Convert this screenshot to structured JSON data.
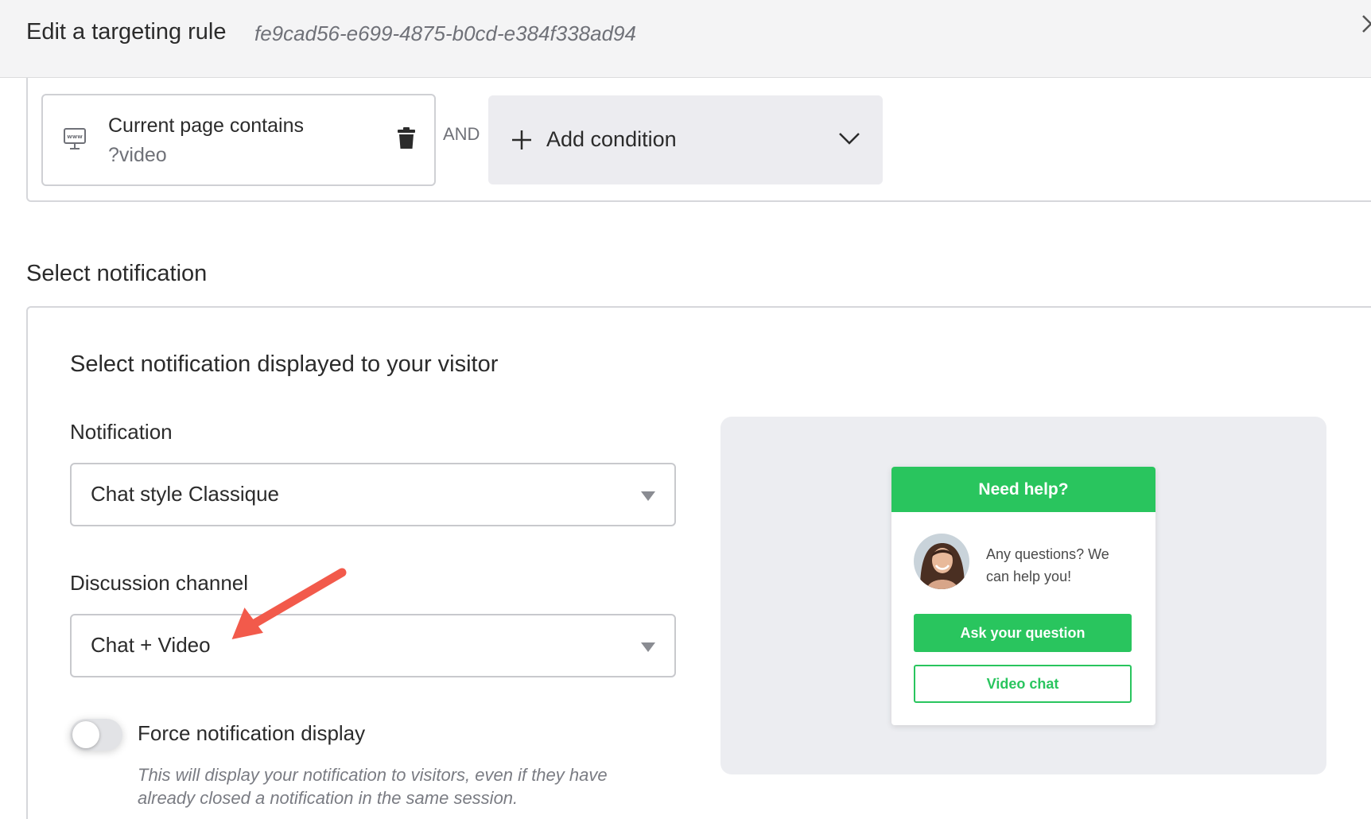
{
  "header": {
    "title": "Edit a targeting rule",
    "rule_id": "fe9cad56-e699-4875-b0cd-e384f338ad94"
  },
  "conditions": {
    "items": [
      {
        "title": "Current page contains",
        "value": "?video",
        "icon": "www-icon"
      }
    ],
    "operator": "AND",
    "add_label": "Add condition"
  },
  "section": {
    "title": "Select notification"
  },
  "notification_panel": {
    "title": "Select notification displayed to your visitor",
    "notification_label": "Notification",
    "notification_value": "Chat style Classique",
    "channel_label": "Discussion channel",
    "channel_value": "Chat + Video",
    "force_label": "Force notification display",
    "force_help": "This will display your notification to visitors, even if they have already closed a notification in the same session.",
    "force_enabled": false
  },
  "preview": {
    "header": "Need help?",
    "message": "Any questions? We can help you!",
    "ask_button": "Ask your question",
    "video_button": "Video chat"
  },
  "colors": {
    "accent_green": "#29c55e",
    "annotation_arrow": "#f25a4b",
    "header_bg": "#f4f4f5",
    "preview_bg": "#ecedf1"
  }
}
